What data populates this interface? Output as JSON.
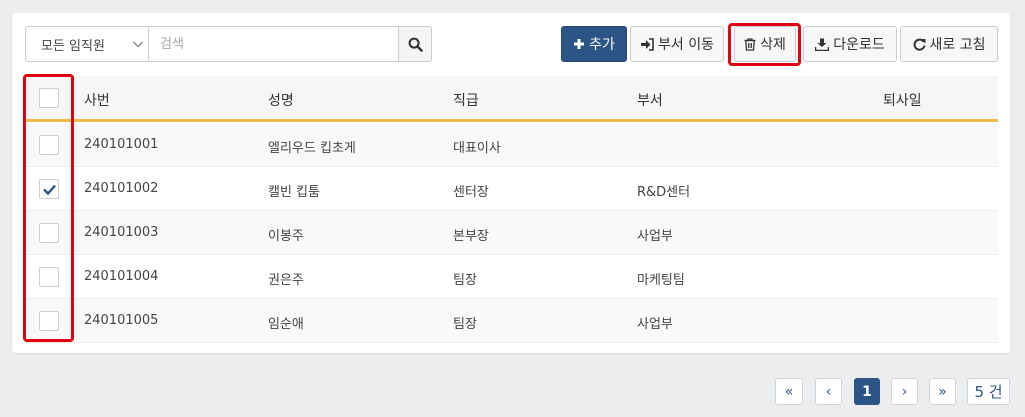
{
  "toolbar": {
    "filter_value": "모든 임직원",
    "search_placeholder": "검색",
    "add_label": "추가",
    "move_label": "부서 이동",
    "delete_label": "삭제",
    "download_label": "다운로드",
    "refresh_label": "새로 고침"
  },
  "table": {
    "headers": {
      "id": "사번",
      "name": "성명",
      "rank": "직급",
      "dept": "부서",
      "retire": "퇴사일"
    },
    "rows": [
      {
        "id": "240101001",
        "name": "엘리우드 킵초게",
        "rank": "대표이사",
        "dept": "",
        "retire": "",
        "checked": false
      },
      {
        "id": "240101002",
        "name": "캘빈 킵툼",
        "rank": "센터장",
        "dept": "R&D센터",
        "retire": "",
        "checked": true
      },
      {
        "id": "240101003",
        "name": "이봉주",
        "rank": "본부장",
        "dept": "사업부",
        "retire": "",
        "checked": false
      },
      {
        "id": "240101004",
        "name": "권은주",
        "rank": "팀장",
        "dept": "마케팅팀",
        "retire": "",
        "checked": false
      },
      {
        "id": "240101005",
        "name": "임순애",
        "rank": "팀장",
        "dept": "사업부",
        "retire": "",
        "checked": false
      }
    ]
  },
  "pagination": {
    "first": "«",
    "prev": "‹",
    "current_page": "1",
    "next": "›",
    "last": "»",
    "count": "5 건"
  },
  "colors": {
    "primary": "#2c5586",
    "header_underline": "#f1b94a",
    "highlight": "#e1000f"
  },
  "icons": [
    "chevron-down-icon",
    "search-icon",
    "plus-icon",
    "sign-in-icon",
    "trash-icon",
    "download-icon",
    "refresh-icon",
    "check-icon"
  ]
}
